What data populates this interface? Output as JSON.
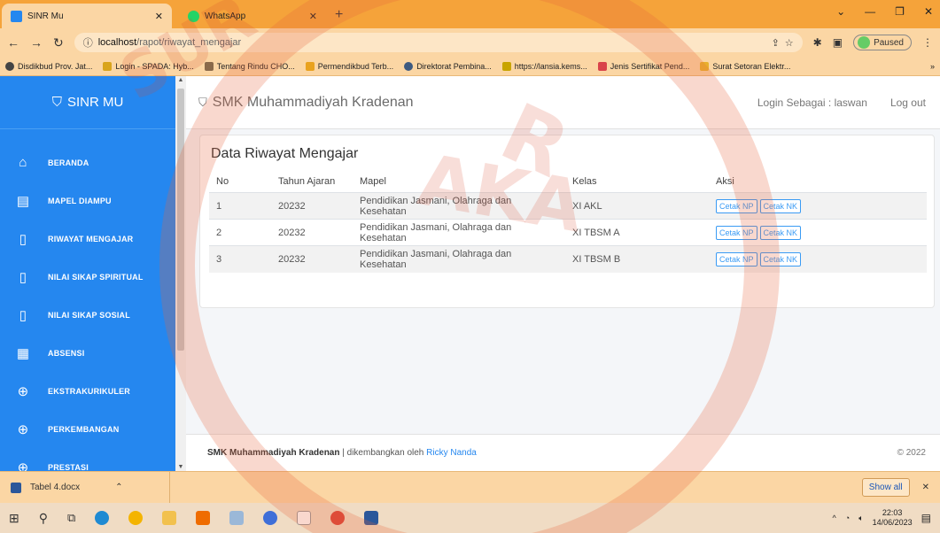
{
  "browser": {
    "tabs": [
      {
        "title": "SINR Mu",
        "active": true
      },
      {
        "title": "WhatsApp",
        "active": false
      }
    ],
    "address": {
      "host": "localhost",
      "path": "/rapot/riwayat_mengajar"
    },
    "profile_status": "Paused",
    "bookmarks": [
      "Disdikbud Prov. Jat...",
      "Login - SPADA: Hyb...",
      "Tentang Rindu CHO...",
      "Permendikbud Terb...",
      "Direktorat Pembina...",
      "https://lansia.kems...",
      "Jenis Sertifikat Pend...",
      "Surat Setoran Elektr..."
    ]
  },
  "sidebar": {
    "brand": "SINR MU",
    "items": [
      {
        "label": "BERANDA",
        "icon": "home-icon"
      },
      {
        "label": "MAPEL DIAMPU",
        "icon": "document-list-icon"
      },
      {
        "label": "RIWAYAT MENGAJAR",
        "icon": "file-icon"
      },
      {
        "label": "NILAI SIKAP SPIRITUAL",
        "icon": "file-icon"
      },
      {
        "label": "NILAI SIKAP SOSIAL",
        "icon": "file-icon"
      },
      {
        "label": "ABSENSI",
        "icon": "calendar-icon"
      },
      {
        "label": "EKSTRAKURIKULER",
        "icon": "ball-icon"
      },
      {
        "label": "PERKEMBANGAN",
        "icon": "ball-icon"
      },
      {
        "label": "PRESTASI",
        "icon": "ball-icon"
      }
    ]
  },
  "topnav": {
    "school": "SMK Muhammadiyah Kradenan",
    "login_as": "Login Sebagai : laswan",
    "logout": "Log out"
  },
  "card": {
    "title": "Data Riwayat Mengajar",
    "columns": [
      "No",
      "Tahun Ajaran",
      "Mapel",
      "Kelas",
      "Aksi"
    ],
    "rows": [
      {
        "no": "1",
        "tahun": "20232",
        "mapel": "Pendidikan Jasmani, Olahraga dan Kesehatan",
        "kelas": "XI AKL",
        "btn1": "Cetak NP",
        "btn2": "Cetak NK"
      },
      {
        "no": "2",
        "tahun": "20232",
        "mapel": "Pendidikan Jasmani, Olahraga dan Kesehatan",
        "kelas": "XI TBSM A",
        "btn1": "Cetak NP",
        "btn2": "Cetak NK"
      },
      {
        "no": "3",
        "tahun": "20232",
        "mapel": "Pendidikan Jasmani, Olahraga dan Kesehatan",
        "kelas": "XI TBSM B",
        "btn1": "Cetak NP",
        "btn2": "Cetak NK"
      }
    ]
  },
  "footer": {
    "school": "SMK Muhammadiyah Kradenan",
    "text": " | dikembangkan oleh ",
    "author": "Ricky Nanda",
    "copyright": "© 2022"
  },
  "download_bar": {
    "file": "Tabel 4.docx",
    "show_all": "Show all"
  },
  "taskbar": {
    "time": "22:03",
    "date": "14/06/2023"
  },
  "colors": {
    "sidebar": "#2587ef",
    "browser_frame": "#f5a33a",
    "accent": "#3a9bf4"
  }
}
